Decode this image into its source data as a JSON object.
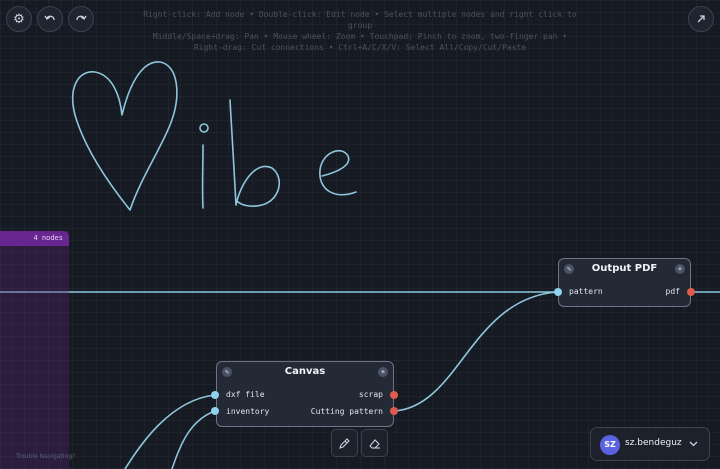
{
  "toolbar": {
    "settings_icon": "gear-icon",
    "undo_icon": "undo-icon",
    "redo_icon": "redo-icon",
    "expand_icon": "expand-icon"
  },
  "help": {
    "line1": "Right-click: Add node • Double-click: Edit node • Select multiple nodes and right click to group",
    "line2": "Middle/Space+drag: Pan • Mouse wheel: Zoom • Touchpad: Pinch to zoom, two-finger pan •",
    "line3": "Right-drag: Cut connections • Ctrl+A/C/X/V: Select All/Copy/Cut/Paste"
  },
  "drawing": {
    "text": "Vibe",
    "color": "#8fc6dc"
  },
  "group": {
    "label": "4 nodes",
    "color": "#6a2690"
  },
  "nodes": {
    "output_pdf": {
      "title": "Output PDF",
      "input": "pattern",
      "output": "pdf"
    },
    "canvas": {
      "title": "Canvas",
      "inputs": [
        "dxf file",
        "inventory"
      ],
      "outputs": [
        "scrap",
        "Cutting pattern"
      ]
    }
  },
  "colors": {
    "input_port": "#8ed2f0",
    "output_port": "#e05a4d",
    "wire": "#8fc6dc",
    "avatar": "#5b62e0"
  },
  "tools": [
    "pen-icon",
    "eraser-icon"
  ],
  "footer": {
    "trouble": "Trouble Navigating?"
  },
  "user": {
    "initials": "SZ",
    "name": "sz.bendeguz"
  }
}
